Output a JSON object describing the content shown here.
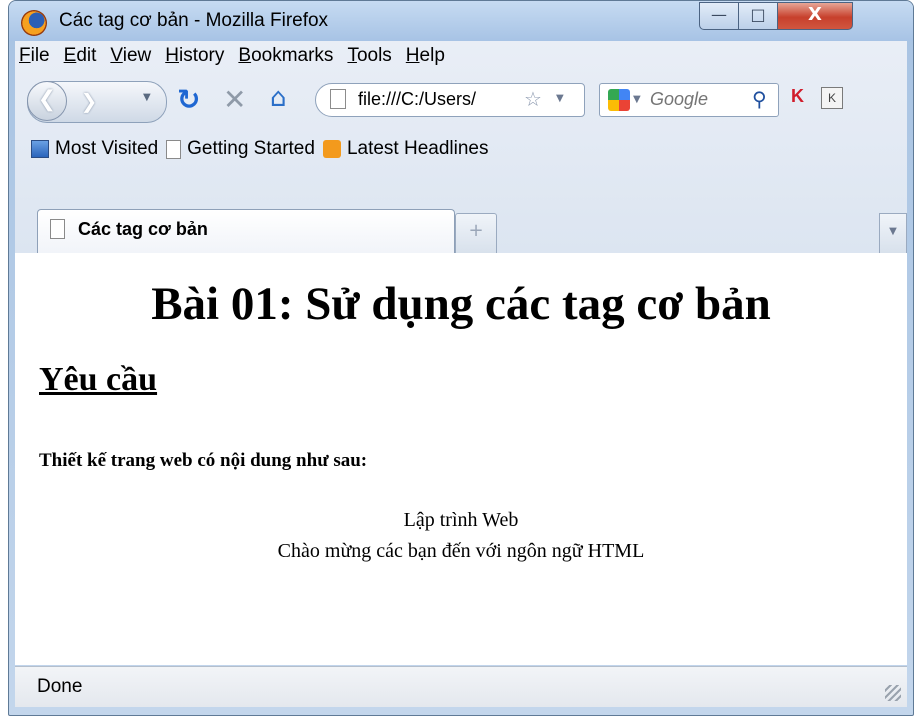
{
  "window": {
    "title": "Các tag cơ bản - Mozilla Firefox",
    "minimize_glyph": "—",
    "maximize_glyph": "□",
    "close_glyph": "X"
  },
  "menu": [
    "File",
    "Edit",
    "View",
    "History",
    "Bookmarks",
    "Tools",
    "Help"
  ],
  "navbar": {
    "url": "file:///C:/Users/",
    "search_placeholder": "Google"
  },
  "bookmarks": [
    "Most Visited",
    "Getting Started",
    "Latest Headlines"
  ],
  "tabs": [
    {
      "label": "Các tag cơ bản"
    }
  ],
  "page": {
    "heading": "Bài 01: Sử dụng các tag cơ bản",
    "subheading": "Yêu cầu",
    "lead": "Thiết kế trang web có nội dung như sau:",
    "line1": "Lập trình Web",
    "line2": "Chào mừng các bạn đến với ngôn ngữ HTML"
  },
  "status": "Done",
  "colors": {
    "titlebar": "#b9d1ea",
    "close_button": "#c7402c",
    "link_accent": "#1f67d2"
  }
}
